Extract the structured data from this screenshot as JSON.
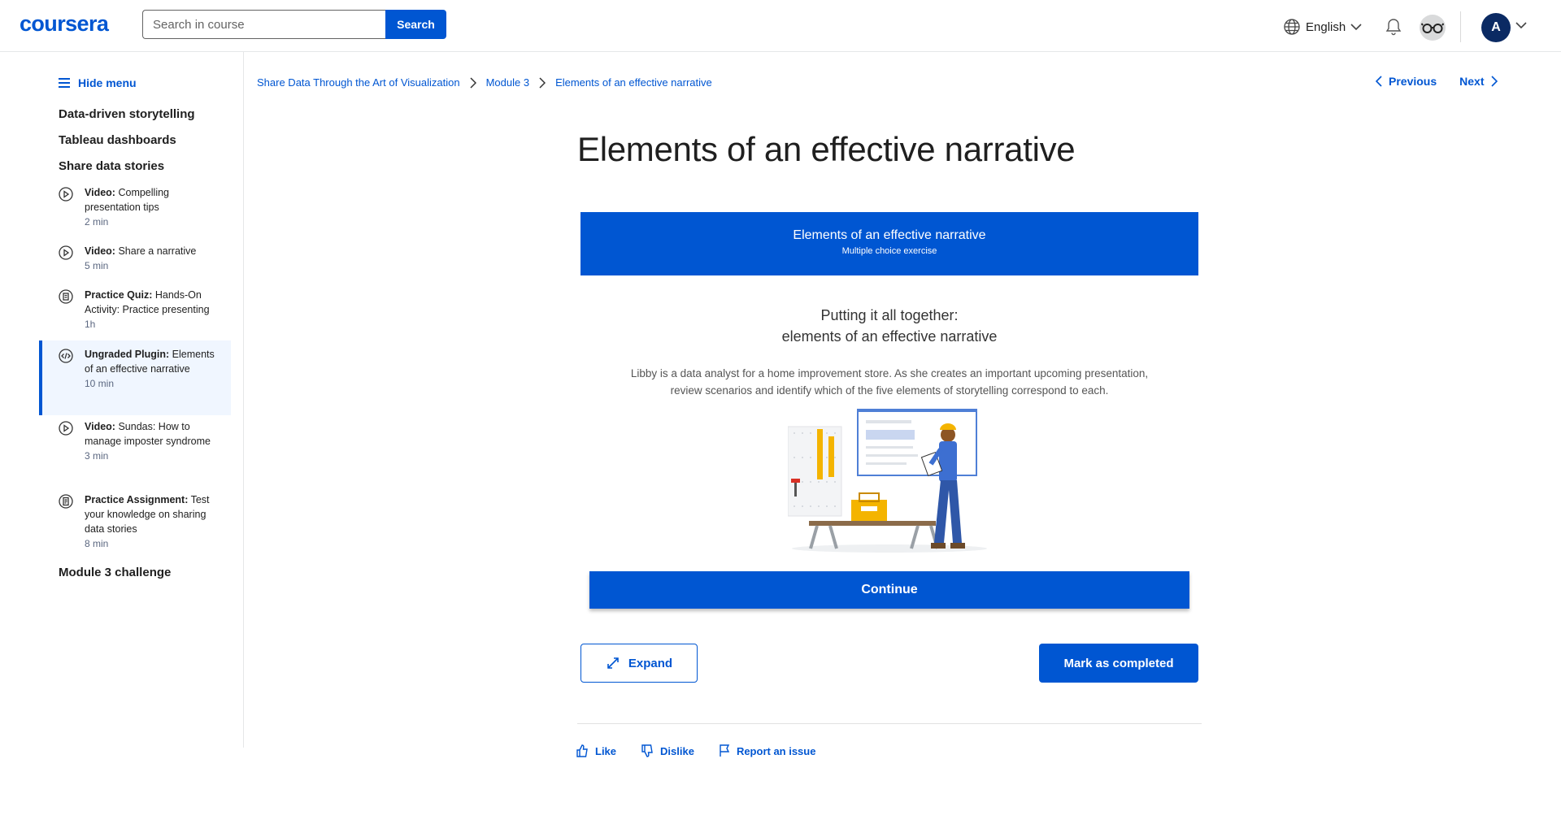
{
  "header": {
    "logo": "coursera",
    "search_placeholder": "Search in course",
    "search_button": "Search",
    "language": "English",
    "avatar_initial": "A"
  },
  "sidebar": {
    "hide_menu": "Hide menu",
    "sections": [
      "Data-driven storytelling",
      "Tableau dashboards",
      "Share data stories",
      "Module 3 challenge"
    ],
    "items": [
      {
        "type": "Video:",
        "title": "Compelling presentation tips",
        "duration": "2 min",
        "icon": "play-circle-icon"
      },
      {
        "type": "Video:",
        "title": "Share a narrative",
        "duration": "5 min",
        "icon": "play-circle-icon"
      },
      {
        "type": "Practice Quiz:",
        "title": "Hands-On Activity: Practice presenting",
        "duration": "1h",
        "icon": "quiz-icon"
      },
      {
        "type": "Ungraded Plugin:",
        "title": "Elements of an effective narrative",
        "duration": "10 min",
        "icon": "code-icon",
        "active": true
      },
      {
        "type": "Video:",
        "title": "Sundas: How to manage imposter syndrome",
        "duration": "3 min",
        "icon": "play-circle-icon"
      },
      {
        "type": "Practice Assignment:",
        "title": "Test your knowledge on sharing data stories",
        "duration": "8 min",
        "icon": "assignment-icon"
      }
    ]
  },
  "breadcrumbs": [
    "Share Data Through the Art of Visualization",
    "Module 3",
    "Elements of an effective narrative"
  ],
  "nav": {
    "previous": "Previous",
    "next": "Next"
  },
  "page_title": "Elements of an effective narrative",
  "plugin": {
    "banner_title": "Elements of an effective narrative",
    "banner_subtitle": "Multiple choice exercise",
    "scenario_title_line1": "Putting it all together:",
    "scenario_title_line2": "elements of an effective narrative",
    "description_line1": "Libby is a data analyst for a home improvement store. As she creates an important upcoming presentation,",
    "description_line2": "review scenarios and identify which of the five elements of storytelling correspond to each.",
    "continue": "Continue"
  },
  "actions": {
    "expand": "Expand",
    "mark_completed": "Mark as completed"
  },
  "feedback": {
    "like": "Like",
    "dislike": "Dislike",
    "report": "Report an issue"
  },
  "colors": {
    "brand": "#0056d2",
    "active_bg": "#f0f6ff"
  }
}
